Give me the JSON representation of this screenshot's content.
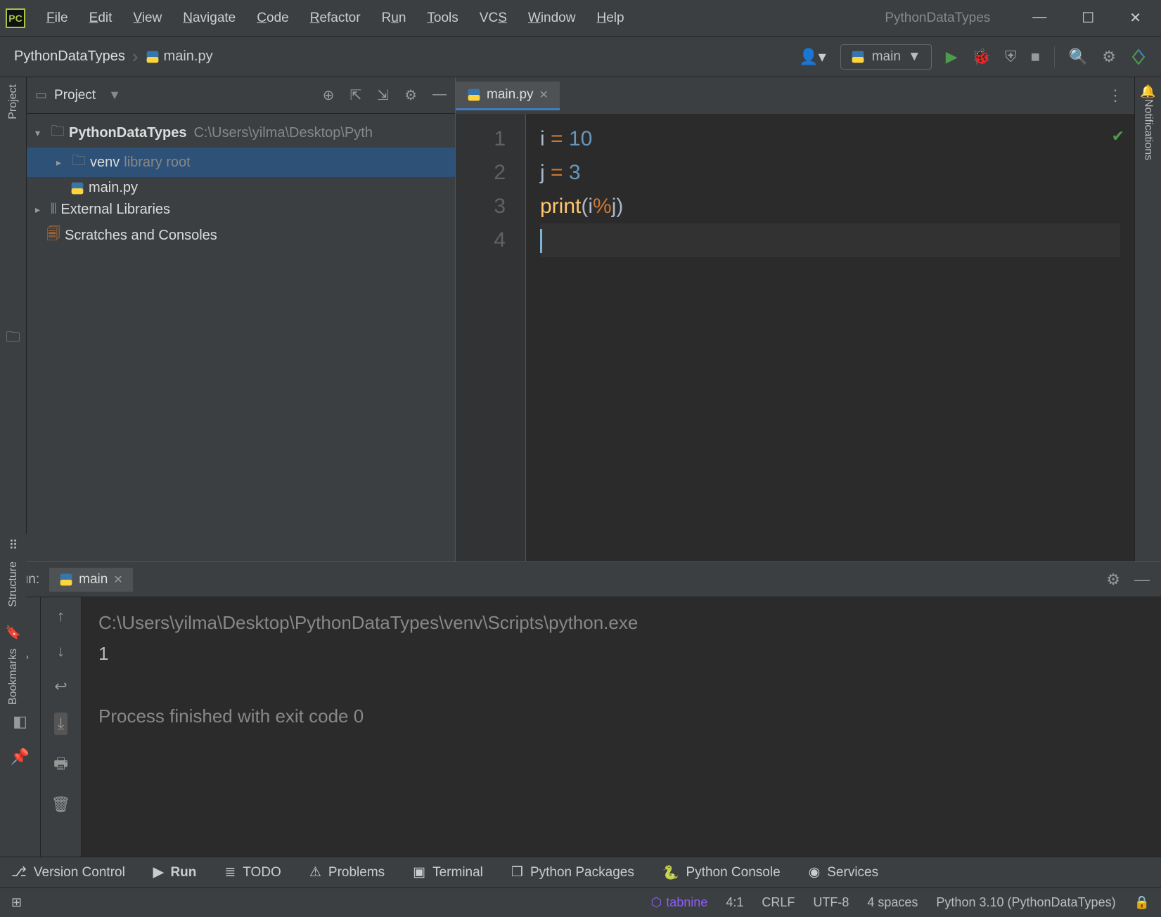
{
  "app": {
    "title": "PythonDataTypes"
  },
  "menu": {
    "file": "File",
    "edit": "Edit",
    "view": "View",
    "navigate": "Navigate",
    "code": "Code",
    "refactor": "Refactor",
    "run": "Run",
    "tools": "Tools",
    "vcs": "VCS",
    "window": "Window",
    "help": "Help"
  },
  "breadcrumb": {
    "project": "PythonDataTypes",
    "file": "main.py"
  },
  "runConfig": {
    "name": "main"
  },
  "projectPanel": {
    "title": "Project"
  },
  "tree": {
    "root": {
      "name": "PythonDataTypes",
      "path": "C:\\Users\\yilma\\Desktop\\Pyth"
    },
    "venv": {
      "name": "venv",
      "note": "library root"
    },
    "mainpy": "main.py",
    "ext": "External Libraries",
    "scratch": "Scratches and Consoles"
  },
  "editor": {
    "tab": "main.py",
    "gutter": [
      "1",
      "2",
      "3",
      "4"
    ],
    "code": {
      "l1": {
        "var": "i",
        "op": "=",
        "num": "10"
      },
      "l2": {
        "var": "j",
        "op": "=",
        "num": "3"
      },
      "l3": {
        "fn": "print",
        "p1": "(",
        "a": "i",
        "mod": "%",
        "b": "j",
        "p2": ")"
      }
    }
  },
  "run": {
    "label": "Run:",
    "tab": "main",
    "path": "C:\\Users\\yilma\\Desktop\\PythonDataTypes\\venv\\Scripts\\python.exe",
    "output": "1",
    "exit": "Process finished with exit code 0"
  },
  "leftTabs": {
    "project": "Project",
    "structure": "Structure",
    "bookmarks": "Bookmarks"
  },
  "rightTabs": {
    "notifications": "Notifications"
  },
  "bottomBar": {
    "vc": "Version Control",
    "run": "Run",
    "todo": "TODO",
    "problems": "Problems",
    "terminal": "Terminal",
    "packages": "Python Packages",
    "console": "Python Console",
    "services": "Services"
  },
  "statusBar": {
    "tabnine": "tabnine",
    "pos": "4:1",
    "eol": "CRLF",
    "enc": "UTF-8",
    "indent": "4 spaces",
    "interp": "Python 3.10 (PythonDataTypes)"
  }
}
